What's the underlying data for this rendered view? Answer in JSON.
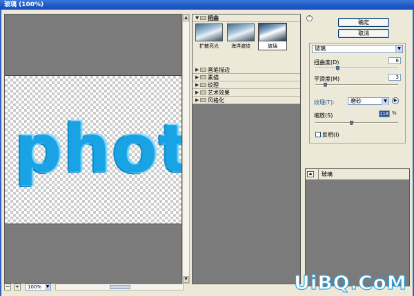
{
  "window": {
    "title": "玻璃 (100%)"
  },
  "preview": {
    "sample_text": "phot"
  },
  "zoom": {
    "minus": "−",
    "plus": "+",
    "value": "100%"
  },
  "gallery": {
    "categories": [
      {
        "label": "扭曲",
        "open": true
      },
      {
        "label": "画笔描边"
      },
      {
        "label": "素描"
      },
      {
        "label": "纹理"
      },
      {
        "label": "艺术效果"
      },
      {
        "label": "风格化"
      }
    ],
    "thumbs": [
      {
        "label": "扩散亮光",
        "selected": false
      },
      {
        "label": "海洋波纹",
        "selected": false
      },
      {
        "label": "玻璃",
        "selected": true
      }
    ]
  },
  "buttons": {
    "ok": "确定",
    "cancel": "取消"
  },
  "settings": {
    "filter": "玻璃",
    "distortion_label": "扭曲度(D)",
    "distortion_value": "6",
    "smoothness_label": "平滑度(M)",
    "smoothness_value": "3",
    "texture_label": "纹理(T):",
    "texture_value": "磨砂",
    "scale_label": "缩放(S)",
    "scale_value": "118",
    "scale_unit": "%",
    "invert_label": "反相(I)"
  },
  "layers": {
    "items": [
      {
        "name": "玻璃"
      }
    ]
  },
  "watermark": "UiBQ.CoM",
  "colors": {
    "title_bar": "#1f57c7",
    "text_fill": "#1aa3e4",
    "panel_bg": "#ece9d8",
    "canvas_bg": "#7b7b7b"
  }
}
